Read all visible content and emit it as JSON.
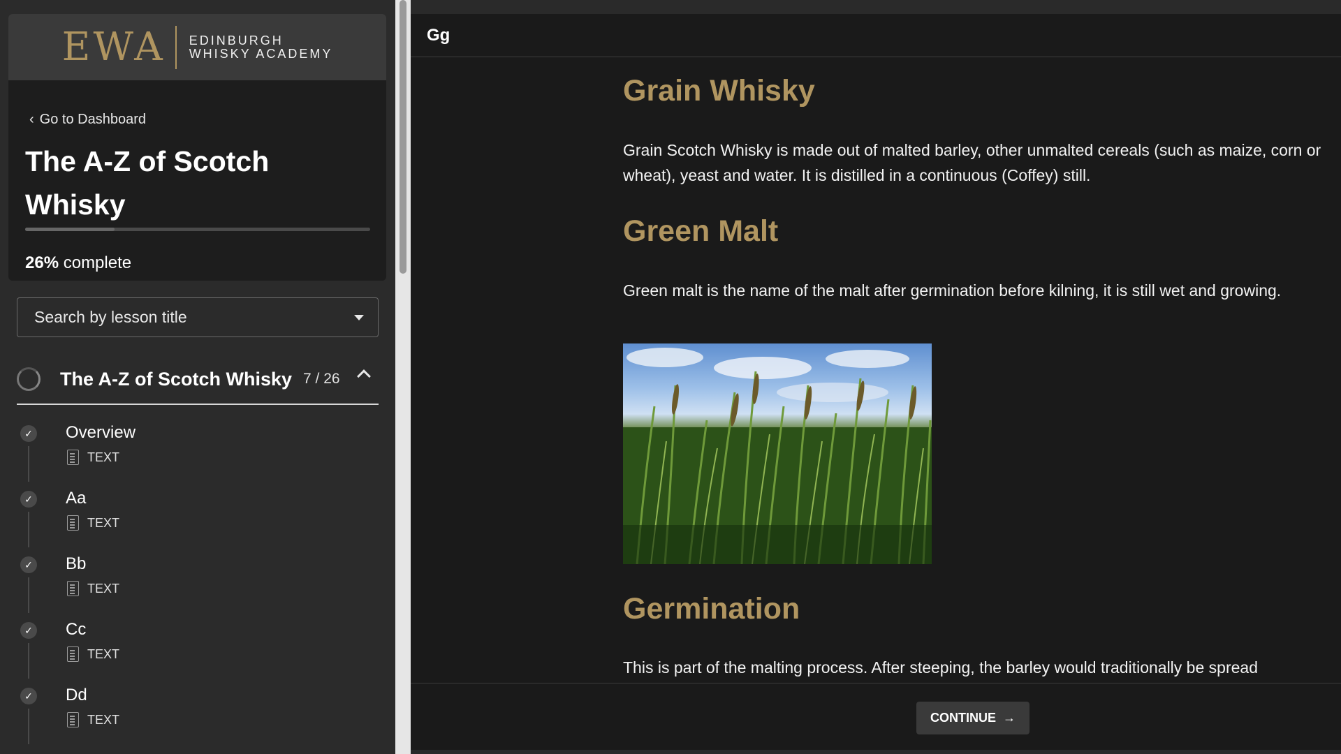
{
  "brand": {
    "logo_mark": "EWA",
    "name_line1": "EDINBURGH",
    "name_line2": "WHISKY ACADEMY",
    "accent_color": "#b09560"
  },
  "sidebar": {
    "back_link": "Go to Dashboard",
    "course_title": "The A-Z of Scotch Whisky",
    "progress_percent": 26,
    "progress_value": "26%",
    "progress_suffix": "complete",
    "search_placeholder": "Search by lesson title",
    "section": {
      "title": "The A-Z of Scotch Whisky",
      "count": "7 / 26"
    },
    "lessons": [
      {
        "name": "Overview",
        "type": "TEXT"
      },
      {
        "name": "Aa",
        "type": "TEXT"
      },
      {
        "name": "Bb",
        "type": "TEXT"
      },
      {
        "name": "Cc",
        "type": "TEXT"
      },
      {
        "name": "Dd",
        "type": "TEXT"
      }
    ]
  },
  "main": {
    "header_title": "Gg",
    "sections": [
      {
        "heading": "Grain Whisky",
        "body": "Grain Scotch Whisky is made out of malted barley, other unmalted cereals (such as maize, corn or wheat), yeast and water. It is distilled in a continuous (Coffey) still."
      },
      {
        "heading": "Green Malt",
        "body": "Green malt is the name of the malt after germination before kilning, it is still wet and growing."
      },
      {
        "heading": "Germination",
        "body": "This is part of the malting process. After steeping, the barley would traditionally be spread"
      }
    ],
    "continue_label": "CONTINUE"
  }
}
